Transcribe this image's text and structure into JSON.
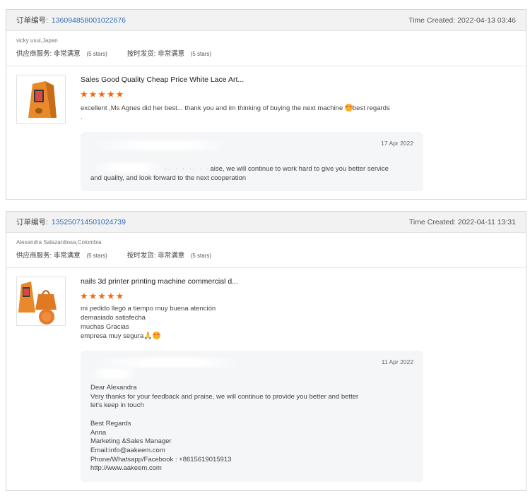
{
  "orders": [
    {
      "order_label": "订单编号:",
      "order_id": "1360948580010​22676",
      "created": "Time Created: 2022-04-13 03:46",
      "buyer": "vicky usui,Japan",
      "supplier_service_label": "供应商服务:",
      "supplier_service_value": "非常满意",
      "supplier_service_stars": "(5 stars)",
      "shipping_label": "按时发货:",
      "shipping_value": "非常满意",
      "shipping_stars": "(5 stars)",
      "product_title": "Sales Good Quality Cheap Price White Lace Art...",
      "rating": 5,
      "review_lines": [
        "excellent ,Ms Agnes did her best... thank you and im thinking of buying the next machine",
        "best regards",
        "."
      ],
      "reply_date": "17 Apr 2022",
      "reply_lines": [
        "aise, we will continue to work hard to give you better service",
        "and quality, and look forward to the next cooperation"
      ]
    },
    {
      "order_label": "订单编号:",
      "order_id": "135250714501024739",
      "created": "Time Created: 2022-04-11 13:31",
      "buyer": "Alexandra Salazardiosa,Colombia",
      "supplier_service_label": "供应商服务:",
      "supplier_service_value": "非常满意",
      "supplier_service_stars": "(5 stars)",
      "shipping_label": "按时发货:",
      "shipping_value": "非常满意",
      "shipping_stars": "(5 stars)",
      "product_title": "nails 3d printer printing machine commercial d...",
      "rating": 5,
      "review_lines": [
        "mi pedido llegó a tiempo muy buena atención",
        "demasiado satisfecha",
        "muchas Gracias",
        "empresa muy segura"
      ],
      "reply_date": "11 Apr 2022",
      "reply_lines": [
        "Dear Alexandra",
        "Very thanks for your feedback and praise, we will continue to provide you better and better",
        "let's keep in touch",
        "",
        "Best Regards",
        "Anna",
        "Marketing &Sales Manager",
        "Email:info@aakeem.com",
        "Phone/Whatsapp/Facebook : +8615619015913",
        "http://www.aakeem.com"
      ]
    }
  ],
  "star_glyphs": "★★★★★",
  "colors": {
    "accent_link": "#2f6db5",
    "star": "#f26a12",
    "header_bg": "#f2f2f2",
    "reply_bg": "#f5f6f8",
    "product_orange": "#e9892a"
  }
}
